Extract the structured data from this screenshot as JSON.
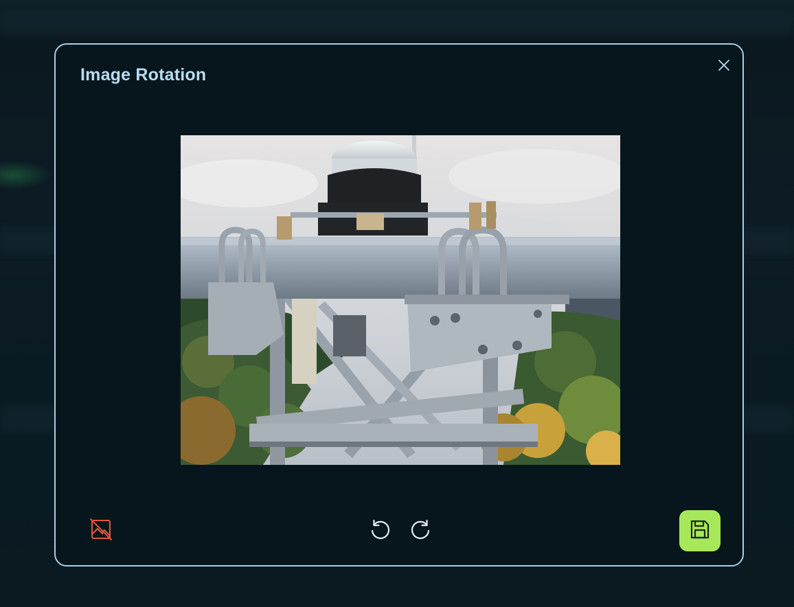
{
  "modal": {
    "title": "Image Rotation"
  },
  "icons": {
    "close": "close-icon",
    "remove_image": "image-off-icon",
    "rotate_left": "rotate-left-icon",
    "rotate_right": "rotate-right-icon",
    "save": "floppy-disk-icon"
  },
  "colors": {
    "modal_border": "#a9cfe6",
    "title": "#b9dcf1",
    "remove_icon": "#e2553e",
    "save_button": "#a7e85a"
  }
}
